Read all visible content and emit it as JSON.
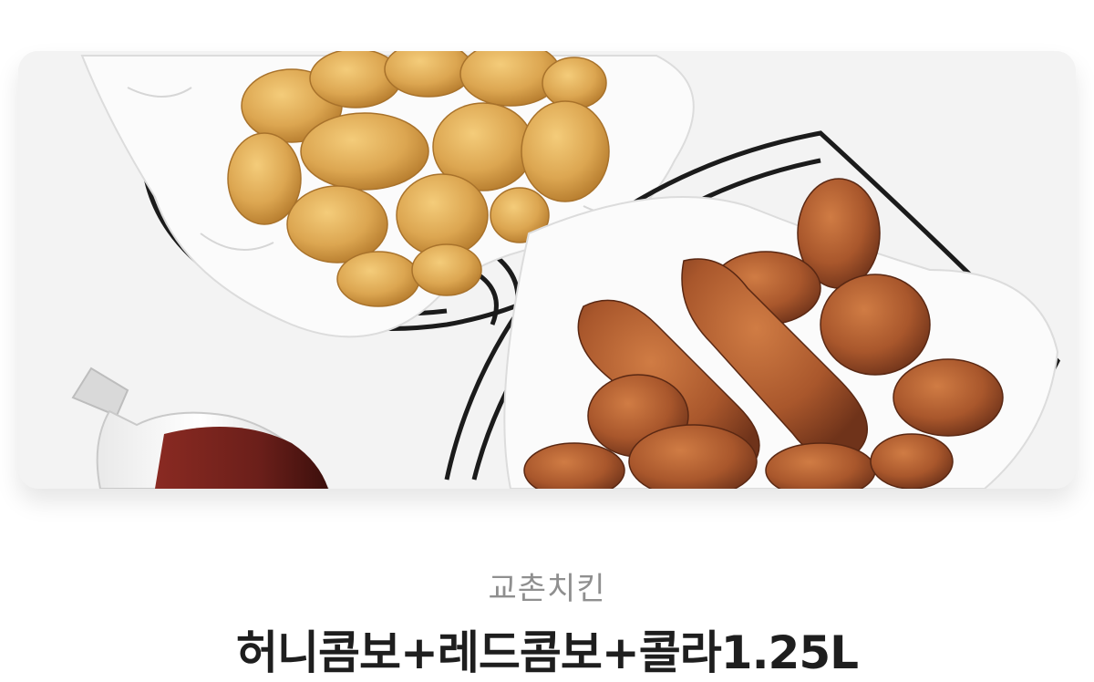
{
  "product": {
    "brand": "교촌치킨",
    "title": "허니콤보+레드콤보+콜라1.25L"
  },
  "colors": {
    "background": "#ffffff",
    "brand_text": "#8f8f8f",
    "title_text": "#1e1e1e",
    "honey_chicken": "#d9a450",
    "red_chicken": "#a9572c",
    "cola": "#6b1f1a"
  }
}
